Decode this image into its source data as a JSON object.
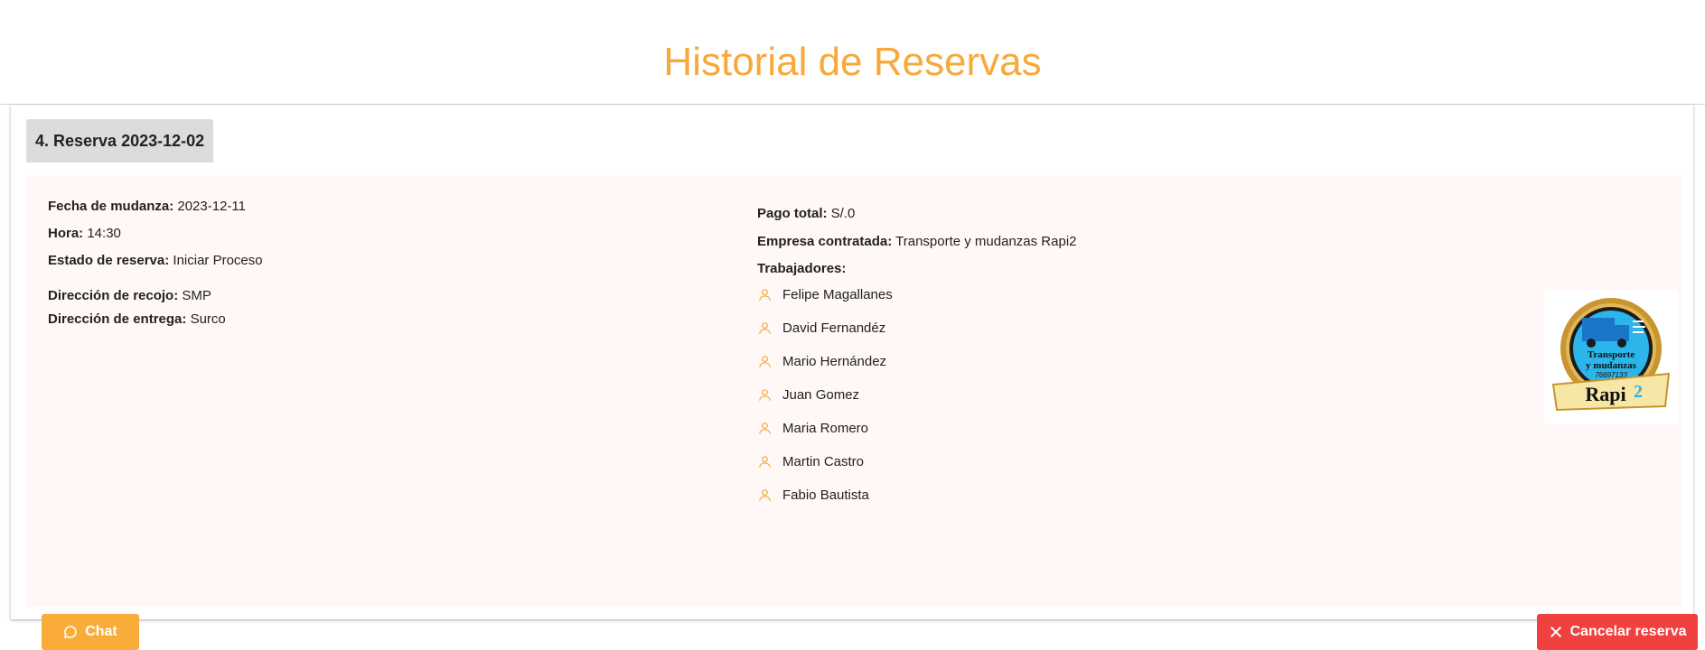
{
  "header": {
    "title": "Historial de Reservas"
  },
  "reservation": {
    "tab_label": "4. Reserva 2023-12-02",
    "left": {
      "fecha_label": "Fecha de mudanza:",
      "fecha_value": "2023-12-11",
      "hora_label": "Hora:",
      "hora_value": "14:30",
      "estado_label": "Estado de reserva:",
      "estado_value": "Iniciar Proceso",
      "recojo_label": "Dirección de recojo:",
      "recojo_value": "SMP",
      "entrega_label": "Dirección de entrega:",
      "entrega_value": "Surco"
    },
    "right": {
      "pago_label": "Pago total:",
      "pago_value": "S/.0",
      "empresa_label": "Empresa contratada:",
      "empresa_value": "Transporte y mudanzas Rapi2",
      "trabajadores_label": "Trabajadores:"
    },
    "workers": [
      "Felipe Magallanes",
      "David Fernandéz",
      "Mario Hernández",
      "Juan Gomez",
      "Maria Romero",
      "Martin Castro",
      "Fabio Bautista"
    ],
    "logo": {
      "line1": "Transporte",
      "line2": "y mudanzas",
      "phone": "76697133",
      "brand": "Rapi",
      "brand_sup": "2"
    }
  },
  "actions": {
    "chat_label": "Chat",
    "cancel_label": "Cancelar reserva"
  },
  "colors": {
    "accent": "#f7a93a",
    "danger": "#f0403f",
    "panel_bg": "#fff8f7"
  },
  "icons": {
    "worker": "user-icon",
    "chat": "chat-bubble-icon",
    "cancel": "close-icon"
  }
}
